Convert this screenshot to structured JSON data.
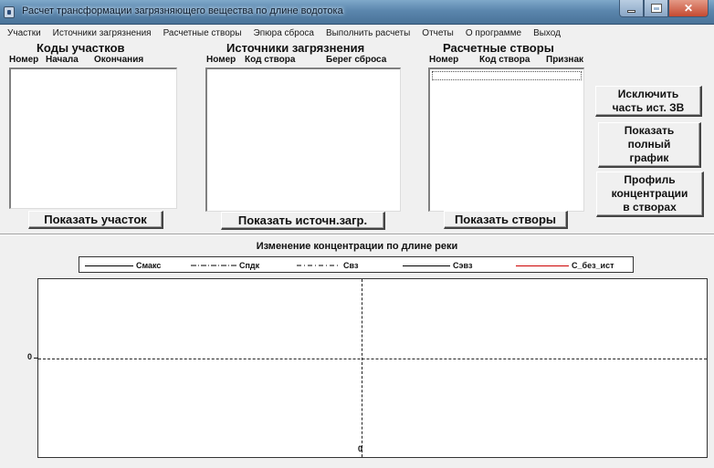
{
  "window": {
    "title": "Расчет трансформации загрязняющего вещества по длине водотока",
    "controls": {
      "minimize": "minimize-icon",
      "maximize": "maximize-icon",
      "close": "✕"
    }
  },
  "menu": [
    "Участки",
    "Источники загрязнения",
    "Расчетные створы",
    "Эпюра сброса",
    "Выполнить расчеты",
    "Отчеты",
    "О программе",
    "Выход"
  ],
  "panels": {
    "sections": {
      "title": "Коды участков",
      "columns": [
        "Номер",
        "Начала",
        "Окончания"
      ],
      "button": "Показать участок"
    },
    "sources": {
      "title": "Источники загрязнения",
      "columns": [
        "Номер",
        "Код створа",
        "Берег сброса"
      ],
      "button": "Показать источн.загр."
    },
    "sites": {
      "title": "Расчетные створы",
      "columns": [
        "Номер",
        "Код створа",
        "Признак"
      ],
      "button": "Показать створы"
    }
  },
  "side_buttons": {
    "exclude": [
      "Исключить",
      "часть ист. ЗВ"
    ],
    "full_graph": [
      "Показать",
      "полный",
      "график"
    ],
    "profile": [
      "Профиль",
      "концентрации",
      "в створах"
    ]
  },
  "chart_data": {
    "type": "line",
    "title": "Изменение концентрации по длине реки",
    "series": [
      {
        "name": "Смакс",
        "style": "solid",
        "color": "#000000",
        "values": []
      },
      {
        "name": "Спдк",
        "style": "dash-dot",
        "color": "#000000",
        "values": []
      },
      {
        "name": "Свз",
        "style": "dash-dot",
        "color": "#000000",
        "values": []
      },
      {
        "name": "Сэвз",
        "style": "solid",
        "color": "#000000",
        "values": []
      },
      {
        "name": "С_без_ист",
        "style": "solid",
        "color": "#cc0000",
        "values": []
      }
    ],
    "x_tick_labels": [
      "0"
    ],
    "y_tick_labels": [
      "0"
    ],
    "grid": "dashed crosshair at 0"
  }
}
